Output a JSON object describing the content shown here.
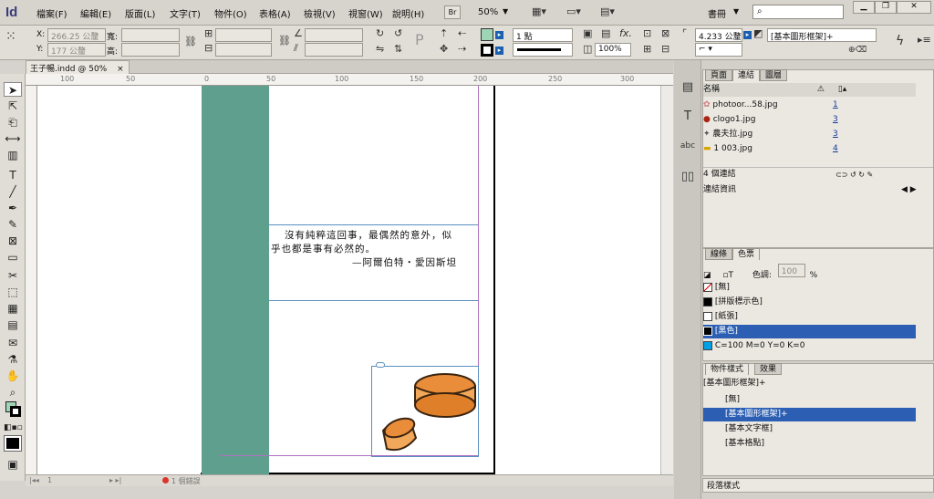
{
  "menubar": {
    "app_logo": "Id",
    "items": [
      "檔案(F)",
      "編輯(E)",
      "版面(L)",
      "文字(T)",
      "物件(O)",
      "表格(A)",
      "檢視(V)",
      "視窗(W)",
      "說明(H)"
    ],
    "bridge_label": "Br",
    "zoom_value": "50%",
    "workspace_label": "書冊",
    "search_placeholder": "",
    "window_controls": [
      "▁",
      "❐",
      "✕"
    ]
  },
  "control_bar": {
    "x_label": "X:",
    "y_label": "Y:",
    "x_value": "266.25 公釐",
    "y_value": "177 公釐",
    "w_label": "寬:",
    "h_label": "高:",
    "stroke_weight": "1 點",
    "opacity": "100%",
    "frame_size": "4.233 公釐",
    "object_style": "[基本圖形框架]+"
  },
  "document": {
    "tab_label": "王子暢.indd @ 50%",
    "tab_close": "×",
    "ruler_labels": [
      "100",
      "50",
      "0",
      "50",
      "100",
      "150",
      "200",
      "250",
      "300"
    ],
    "quote_line1": "沒有純粹這回事，最偶然的意外，似",
    "quote_line2": "乎也都是事有必然的。",
    "quote_author": "—阿爾伯特・愛因斯坦"
  },
  "colors": {
    "teal_column": "#5e9f8e",
    "selection_blue": "#2c5fb3",
    "frame_purple": "#b070c0",
    "link_blue": "#123b9c"
  },
  "status_bar": {
    "page_number": "1",
    "error_status": "1 個錯誤"
  },
  "tools": [
    "selection-tool",
    "direct-selection-tool",
    "page-tool",
    "gap-tool",
    "content-collector-tool",
    "type-tool",
    "line-tool",
    "pen-tool",
    "pencil-tool",
    "rectangle-frame-tool",
    "rectangle-tool",
    "scissors-tool",
    "free-transform-tool",
    "gradient-swatch-tool",
    "gradient-feather-tool",
    "note-tool",
    "eyedropper-tool",
    "hand-tool",
    "zoom-tool"
  ],
  "links_panel": {
    "tabs": [
      "頁面",
      "連結",
      "圖層"
    ],
    "name_header": "名稱",
    "items": [
      {
        "name": "photoor...58.jpg",
        "page": "1"
      },
      {
        "name": "clogo1.jpg",
        "page": "3"
      },
      {
        "name": "農夫拉.jpg",
        "page": "3"
      },
      {
        "name": "1 003.jpg",
        "page": "4"
      }
    ],
    "count_label": "4 個連結",
    "info_label": "連結資訊"
  },
  "swatches_panel": {
    "tabs": [
      "線條",
      "色票"
    ],
    "tint_label": "色調:",
    "tint_value": "100",
    "tint_unit": "%",
    "items": [
      {
        "name": "[無]",
        "color": "#ffffff"
      },
      {
        "name": "[拼版標示色]",
        "color": "#000000"
      },
      {
        "name": "[紙張]",
        "color": "#ffffff"
      },
      {
        "name": "[黑色]",
        "color": "#000000"
      },
      {
        "name": "C=100 M=0 Y=0 K=0",
        "color": "#00a0e6"
      }
    ]
  },
  "object_styles_panel": {
    "tabs": [
      "物件樣式",
      "效果"
    ],
    "current": "[基本圖形框架]+",
    "items": [
      "[無]",
      "[基本圖形框架]+",
      "[基本文字框]",
      "[基本格點]"
    ]
  },
  "paragraph_styles_panel": {
    "title": "段落樣式"
  }
}
